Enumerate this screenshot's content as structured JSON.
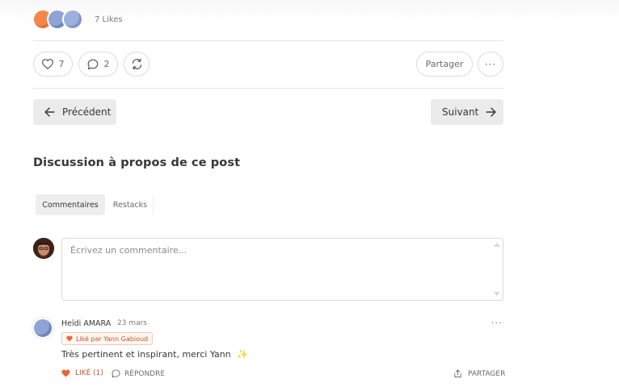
{
  "likes": {
    "count_text": "7 Likes"
  },
  "actions": {
    "like_count": "7",
    "comment_count": "2",
    "share_label": "Partager",
    "more_label": "···"
  },
  "nav": {
    "prev_label": "Précédent",
    "next_label": "Suivant"
  },
  "discussion": {
    "title": "Discussion à propos de ce post",
    "tabs": [
      {
        "label": "Commentaires",
        "active": true
      },
      {
        "label": "Restacks",
        "active": false
      }
    ],
    "input_placeholder": "Écrivez un commentaire..."
  },
  "comment": {
    "author": "Heïdi AMARA",
    "date": "23 mars",
    "liked_by": "Liké par Yann Gabioud",
    "text": "Très pertinent et inspirant, merci Yann",
    "emoji": "✨",
    "like_label": "LIKÉ (1)",
    "reply_label": "RÉPONDRE",
    "share_label": "PARTAGER",
    "more_label": "···"
  },
  "colors": {
    "accent": "#f4874b",
    "liked": "#c2541f",
    "text": "#363737",
    "muted": "#7a7a7a"
  }
}
